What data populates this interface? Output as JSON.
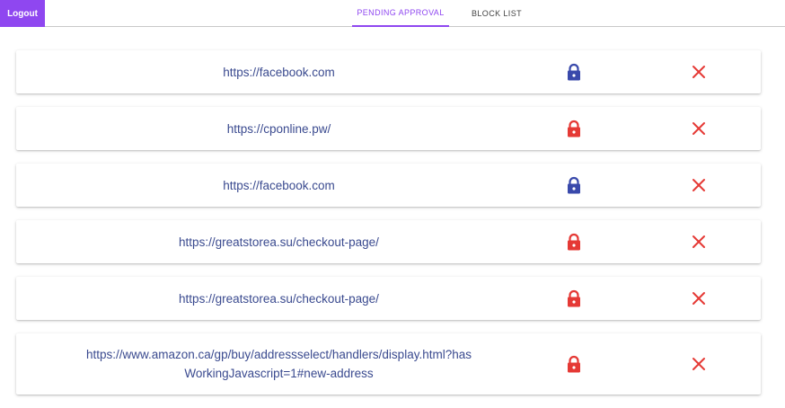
{
  "header": {
    "logout_label": "Logout",
    "tabs": [
      {
        "label": "PENDING APPROVAL",
        "active": true
      },
      {
        "label": "BLOCK LIST",
        "active": false
      }
    ]
  },
  "colors": {
    "accent": "#8f47f0",
    "url_text": "#3a4a8f",
    "lock_approved": "#3949ab",
    "lock_blocked": "#e53935",
    "remove": "#e53935"
  },
  "requests": [
    {
      "url": "https://facebook.com",
      "lock_icon": "lock-icon",
      "lock_state": "blue",
      "remove_icon": "close-icon"
    },
    {
      "url": "https://cponline.pw/",
      "lock_icon": "lock-icon",
      "lock_state": "red",
      "remove_icon": "close-icon"
    },
    {
      "url": "https://facebook.com",
      "lock_icon": "lock-icon",
      "lock_state": "blue",
      "remove_icon": "close-icon"
    },
    {
      "url": "https://greatstorea.su/checkout-page/",
      "lock_icon": "lock-icon",
      "lock_state": "red",
      "remove_icon": "close-icon"
    },
    {
      "url": "https://greatstorea.su/checkout-page/",
      "lock_icon": "lock-icon",
      "lock_state": "red",
      "remove_icon": "close-icon"
    },
    {
      "url": "https://www.amazon.ca/gp/buy/addressselect/handlers/display.html?hasWorkingJavascript=1#new-address",
      "lock_icon": "lock-icon",
      "lock_state": "red",
      "remove_icon": "close-icon"
    }
  ]
}
